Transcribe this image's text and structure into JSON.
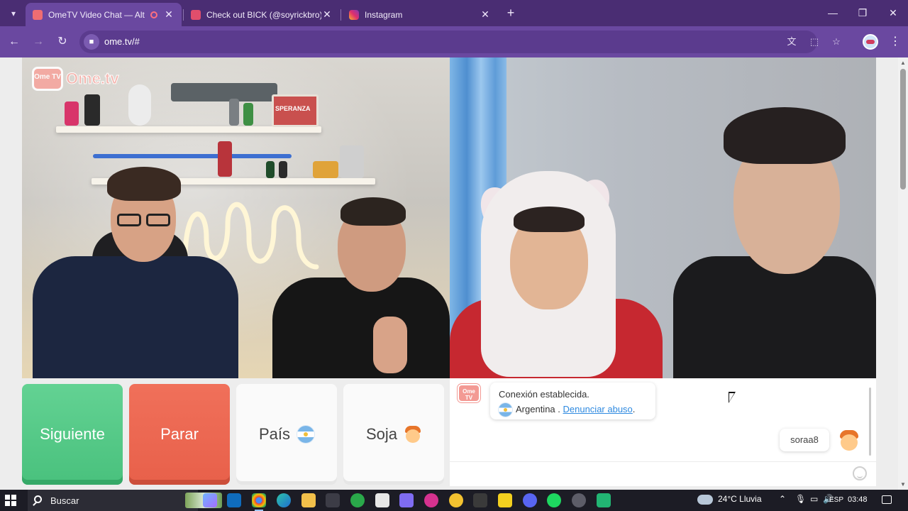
{
  "browser": {
    "tabs": [
      {
        "title": "OmeTV Video Chat — Alter",
        "active": true
      },
      {
        "title": "Check out BICK (@soyrickbro) o",
        "active": false
      },
      {
        "title": "Instagram",
        "active": false
      }
    ],
    "url": "ome.tv/#",
    "colors": {
      "frame": "#4a2d73",
      "toolbar": "#6a48a0"
    }
  },
  "page": {
    "logo": {
      "badge": "Ome TV",
      "text": "Ome.tv"
    },
    "sign_text": "SPERANZA",
    "buttons": {
      "next": "Siguiente",
      "stop": "Parar",
      "country": "País",
      "gender": "Soja"
    },
    "chat": {
      "logo_badge": "Ome TV",
      "system_message": "Conexión establecida.",
      "country": "Argentina",
      "separator": " . ",
      "abuse_link": "Denunciar abuso",
      "abuse_suffix": ".",
      "partner_name": "soraa8",
      "input_value": ""
    }
  },
  "taskbar": {
    "search_placeholder": "Buscar",
    "weather": "24°C  Lluvia",
    "language": "ESP",
    "time": "03:48"
  },
  "colors": {
    "next_button": "#49c17d",
    "stop_button": "#e8604a",
    "link": "#2f8ae0"
  }
}
